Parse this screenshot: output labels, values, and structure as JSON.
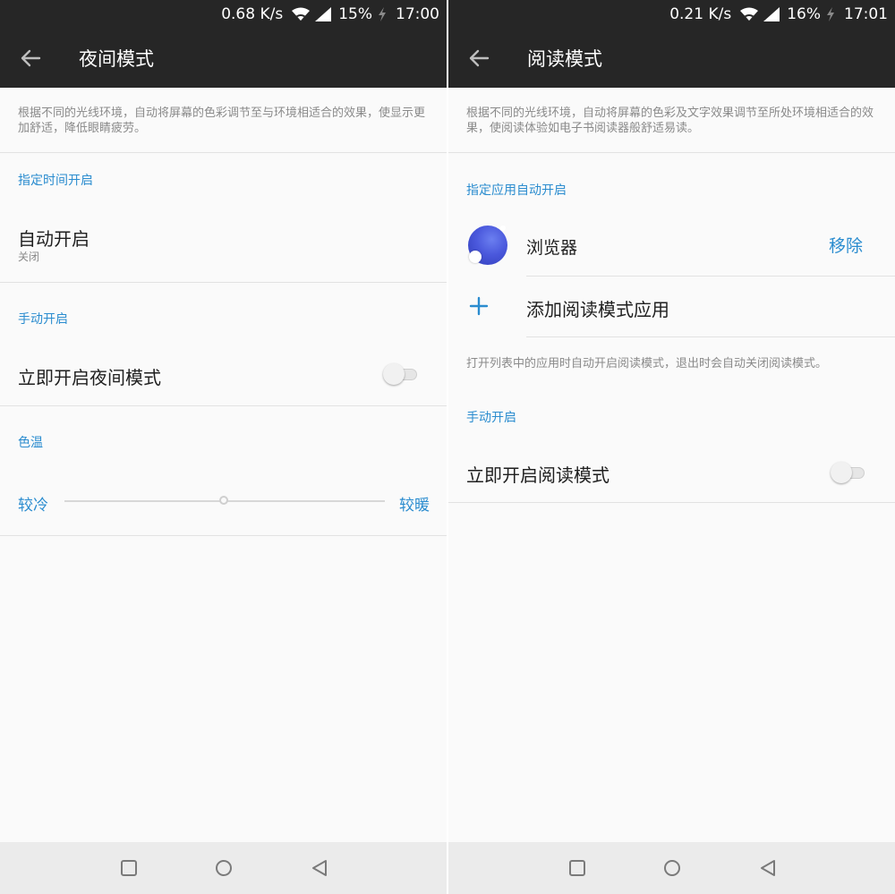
{
  "left": {
    "status": {
      "net_speed": "0.68 K/s",
      "battery": "15%",
      "time": "17:00"
    },
    "appbar": {
      "title": "夜间模式"
    },
    "description": "根据不同的光线环境，自动将屏幕的色彩调节至与环境相适合的效果，使显示更加舒适，降低眼睛疲劳。",
    "sections": {
      "scheduled": {
        "header": "指定时间开启",
        "auto_on_title": "自动开启",
        "auto_on_value": "关闭"
      },
      "manual": {
        "header": "手动开启",
        "toggle_label": "立即开启夜间模式",
        "toggle_on": false
      },
      "color_temp": {
        "header": "色温",
        "cool_label": "较冷",
        "warm_label": "较暖",
        "level": 0.5
      }
    }
  },
  "right": {
    "status": {
      "net_speed": "0.21 K/s",
      "battery": "16%",
      "time": "17:01"
    },
    "appbar": {
      "title": "阅读模式"
    },
    "description": "根据不同的光线环境，自动将屏幕的色彩及文字效果调节至所处环境相适合的效果，使阅读体验如电子书阅读器般舒适易读。",
    "sections": {
      "apps": {
        "header": "指定应用自动开启",
        "items": [
          {
            "name": "浏览器",
            "action": "移除",
            "icon": "browser-icon"
          }
        ],
        "add_label": "添加阅读模式应用",
        "note": "打开列表中的应用时自动开启阅读模式，退出时会自动关闭阅读模式。"
      },
      "manual": {
        "header": "手动开启",
        "toggle_label": "立即开启阅读模式",
        "toggle_on": false
      }
    }
  },
  "colors": {
    "accent": "#2a8ccf",
    "bar": "#262626",
    "background": "#fafafa",
    "navbar": "#ebebeb"
  },
  "icons": {
    "back": "arrow-left-icon",
    "wifi": "wifi-icon",
    "signal": "cell-signal-icon",
    "charging": "charging-bolt-icon",
    "nav_recents": "square-recents-icon",
    "nav_home": "circle-home-icon",
    "nav_back": "triangle-back-icon",
    "add": "plus-icon"
  }
}
